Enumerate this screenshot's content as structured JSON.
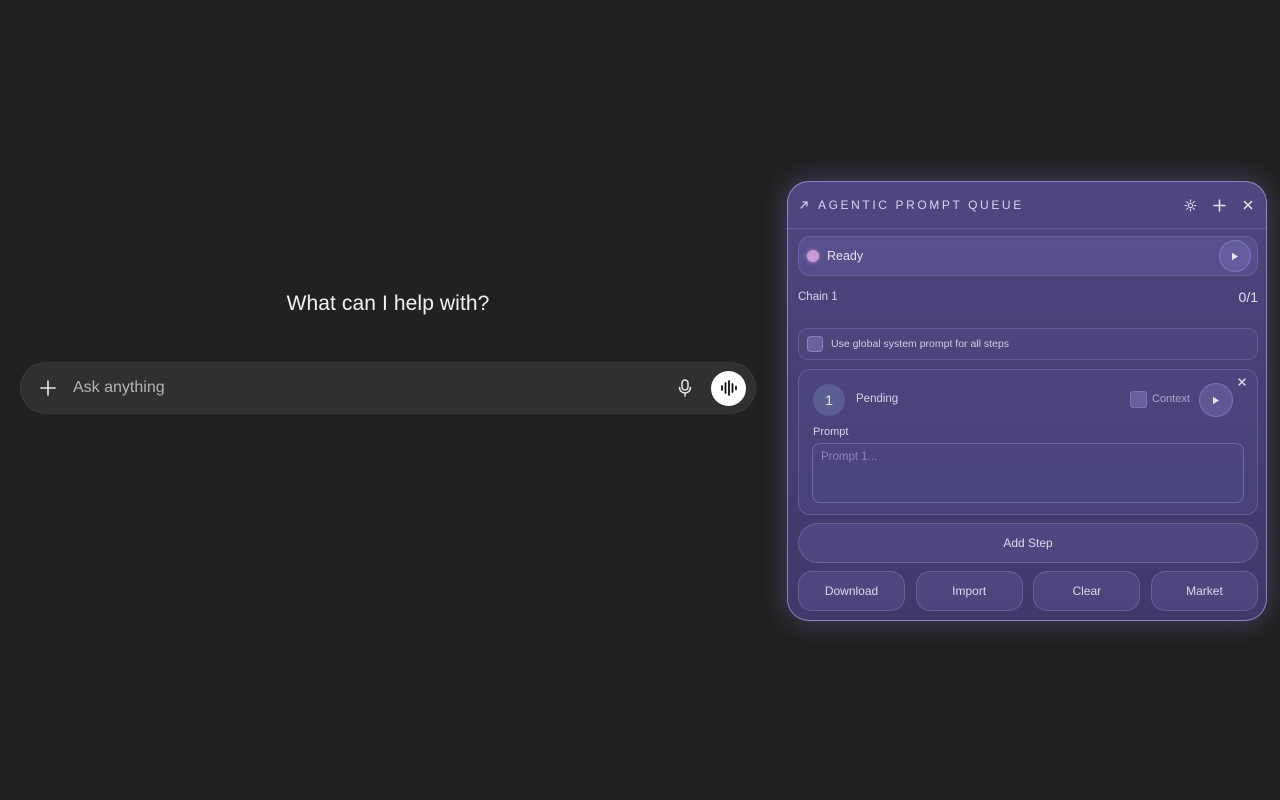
{
  "main": {
    "headline": "What can I help with?",
    "composer": {
      "placeholder": "Ask anything",
      "value": "",
      "icons": [
        "plus-icon",
        "microphone-icon",
        "voice-waveform-icon"
      ]
    }
  },
  "queue_panel": {
    "title": "AGENTIC PROMPT QUEUE",
    "header_icons": [
      "grip-icon",
      "gear-icon",
      "plus-icon",
      "close-icon"
    ],
    "status": {
      "text": "Ready",
      "dot_color": "#c79bd6"
    },
    "chain": {
      "name": "Chain 1",
      "progress": "0/1"
    },
    "global_prompt": {
      "label": "Use global system prompt for all steps",
      "checked": false
    },
    "steps": [
      {
        "number": "1",
        "status": "Pending",
        "context_label": "Context",
        "context_checked": false,
        "prompt_label": "Prompt",
        "prompt_placeholder": "Prompt 1...",
        "prompt_value": ""
      }
    ],
    "add_step_label": "Add Step",
    "actions": {
      "download": "Download",
      "import": "Import",
      "clear": "Clear",
      "market": "Market"
    },
    "accent_color": "#4f4780"
  }
}
